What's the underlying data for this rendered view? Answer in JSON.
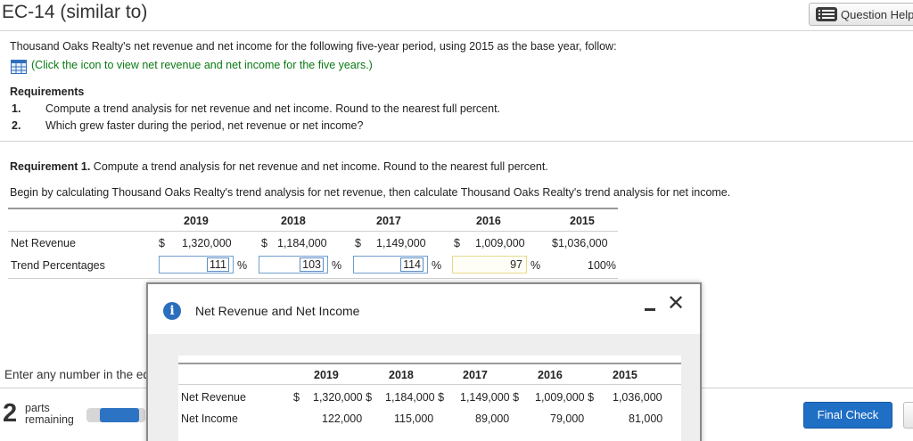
{
  "header": {
    "title": "EC-14 (similar to)",
    "help_label": "Question Help"
  },
  "intro": {
    "statement": "Thousand Oaks Realty's net revenue and net income for the following five-year period, using 2015 as the base year, follow:",
    "link": "(Click the icon to view net revenue and net income for the five years.)"
  },
  "requirements": {
    "heading": "Requirements",
    "items": [
      {
        "num": "1.",
        "text": "Compute a trend analysis for net revenue and net income. Round to the nearest full percent."
      },
      {
        "num": "2.",
        "text": "Which grew faster during the period, net revenue or net income?"
      }
    ]
  },
  "req1": {
    "label_bold": "Requirement 1.",
    "label_rest": " Compute a trend analysis for net revenue and net income. Round to the nearest full percent.",
    "instruction": "Begin by calculating Thousand Oaks Realty's trend analysis for net revenue, then calculate Thousand Oaks Realty's trend analysis for net income."
  },
  "trend_table": {
    "years": [
      "2019",
      "2018",
      "2017",
      "2016",
      "2015"
    ],
    "row_labels": {
      "net_revenue": "Net Revenue",
      "trend": "Trend Percentages"
    },
    "currency": "$",
    "net_revenue": [
      "1,320,000",
      "1,184,000",
      "1,149,000",
      "1,009,000",
      "$1,036,000"
    ],
    "trend_inputs": [
      "111",
      "103",
      "114",
      "97"
    ],
    "trend_base": "100%",
    "percent_sign": "%"
  },
  "modal": {
    "title": "Net Revenue and Net Income",
    "years": [
      "2019",
      "2018",
      "2017",
      "2016",
      "2015"
    ],
    "row_labels": [
      "Net Revenue",
      "Net Income"
    ],
    "net_revenue": [
      "$",
      "1,320,000 $",
      "1,184,000 $",
      "1,149,000 $",
      "1,009,000 $",
      "1,036,000"
    ],
    "net_income": [
      "122,000",
      "115,000",
      "89,000",
      "79,000",
      "81,000"
    ]
  },
  "footer": {
    "enter_text": "Enter any number in the edit fields and then click Check Answer.",
    "parts_count": "2",
    "parts_label_1": "parts",
    "parts_label_2": "remaining",
    "progress_fraction": 0.5,
    "final_check_label": "Final Check"
  },
  "colors": {
    "accent_blue": "#1f6fc5",
    "link_green": "#0a7a14",
    "info_blue": "#2a6ebd"
  }
}
